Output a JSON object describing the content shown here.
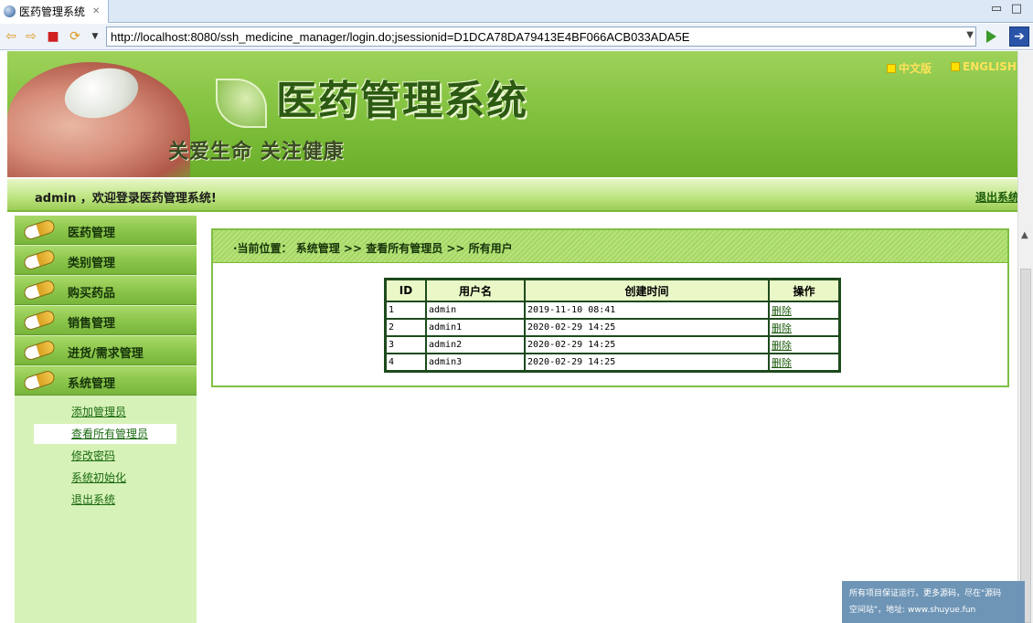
{
  "browser": {
    "tab_title": "医药管理系统",
    "tab_close": "✕",
    "url": "http://localhost:8080/ssh_medicine_manager/login.do;jsessionid=D1DCA78DA79413E4BF066ACB033ADA5E",
    "minimize": "▭",
    "maximize": "□"
  },
  "header": {
    "system_title": "医药管理系统",
    "slogan": "关爱生命  关注健康",
    "lang_cn": "中文版",
    "lang_en": "ENGLISH",
    "welcome": "admin ，欢迎登录医药管理系统!",
    "logout": "退出系统"
  },
  "sidebar": {
    "menus": [
      {
        "label": "医药管理"
      },
      {
        "label": "类别管理"
      },
      {
        "label": "购买药品"
      },
      {
        "label": "销售管理"
      },
      {
        "label": "进货/需求管理"
      },
      {
        "label": "系统管理"
      }
    ],
    "submenu": [
      {
        "label": "添加管理员",
        "active": false
      },
      {
        "label": "查看所有管理员",
        "active": true
      },
      {
        "label": "修改密码",
        "active": false
      },
      {
        "label": "系统初始化",
        "active": false
      },
      {
        "label": "退出系统",
        "active": false
      }
    ]
  },
  "main": {
    "breadcrumb": "·当前位置： 系统管理 >> 查看所有管理员 >> 所有用户",
    "table": {
      "headers": [
        "ID",
        "用户名",
        "创建时间",
        "操作"
      ],
      "rows": [
        {
          "id": "1",
          "username": "admin",
          "created": "2019-11-10 08:41",
          "action": "删除"
        },
        {
          "id": "2",
          "username": "admin1",
          "created": "2020-02-29 14:25",
          "action": "删除"
        },
        {
          "id": "3",
          "username": "admin2",
          "created": "2020-02-29 14:25",
          "action": "删除"
        },
        {
          "id": "4",
          "username": "admin3",
          "created": "2020-02-29 14:25",
          "action": "删除"
        }
      ]
    }
  },
  "watermark": {
    "line1": "所有项目保证运行，更多源码，尽在\"源码",
    "line2": "空间站\"，地址: www.shuyue.fun"
  },
  "colors": {
    "banner_green": "#7fbf3c",
    "menu_green": "#8fc84e",
    "sidebar_bg": "#d7f2b8",
    "table_border": "#1d4a1d",
    "link_green": "#1c5a0c"
  }
}
